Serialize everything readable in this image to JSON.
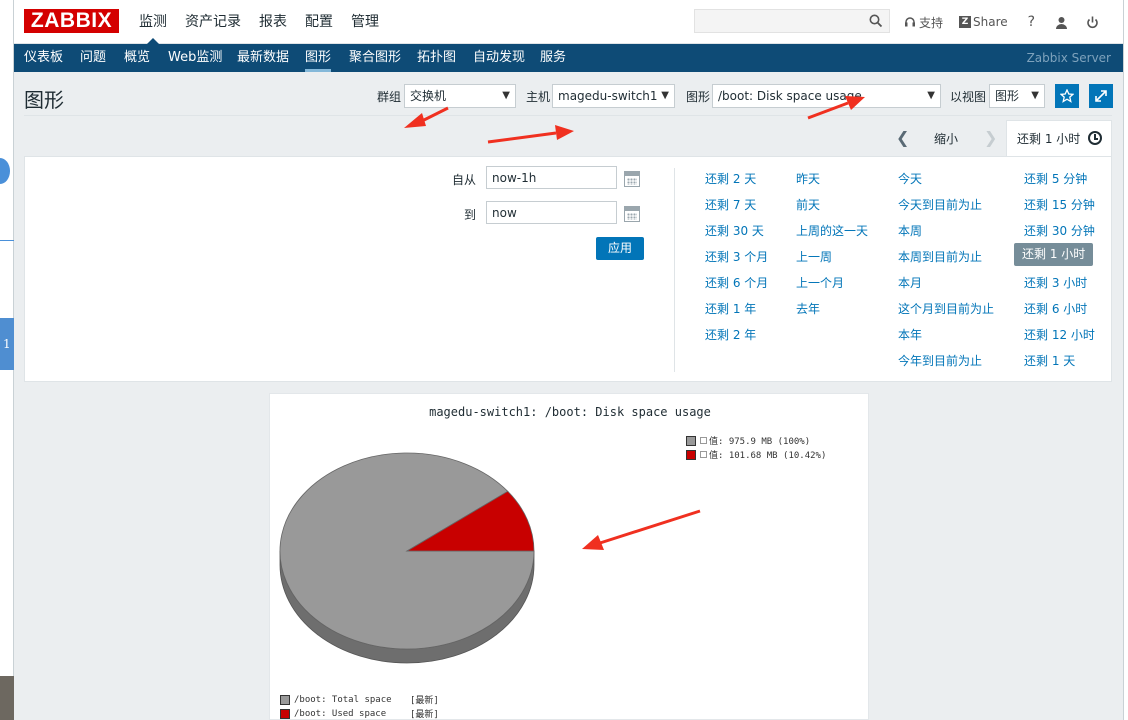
{
  "brand": "ZABBIX",
  "main_menu": [
    "监测",
    "资产记录",
    "报表",
    "配置",
    "管理"
  ],
  "top_links": {
    "support": "支持",
    "share": "Share",
    "help": "?"
  },
  "sub_nav": [
    "仪表板",
    "问题",
    "概览",
    "Web监测",
    "最新数据",
    "图形",
    "聚合图形",
    "拓扑图",
    "自动发现",
    "服务"
  ],
  "server_name": "Zabbix Server",
  "page_title": "图形",
  "filters": {
    "group_label": "群组",
    "group_value": "交换机",
    "host_label": "主机",
    "host_value": "magedu-switch1",
    "graph_label": "图形",
    "graph_value": "/boot: Disk space usage",
    "view_label": "以视图",
    "view_value": "图形"
  },
  "time_tabs": {
    "zoom_out": "缩小",
    "active": "还剩 1 小时"
  },
  "time_filter": {
    "from_label": "自从",
    "from_value": "now-1h",
    "to_label": "到",
    "to_value": "now",
    "apply": "应用"
  },
  "quick_ranges": {
    "col1": [
      "还剩 2 天",
      "还剩 7 天",
      "还剩 30 天",
      "还剩 3 个月",
      "还剩 6 个月",
      "还剩 1 年",
      "还剩 2 年"
    ],
    "col2": [
      "昨天",
      "前天",
      "上周的这一天",
      "上一周",
      "上一个月",
      "去年"
    ],
    "col3": [
      "今天",
      "今天到目前为止",
      "本周",
      "本周到目前为止",
      "本月",
      "这个月到目前为止",
      "本年",
      "今年到目前为止"
    ],
    "col4": [
      "还剩 5 分钟",
      "还剩 15 分钟",
      "还剩 30 分钟",
      "还剩 1 小时",
      "还剩 3 小时",
      "还剩 6 小时",
      "还剩 12 小时",
      "还剩 1 天"
    ],
    "selected": "还剩 1 小时"
  },
  "graph": {
    "title": "magedu-switch1: /boot: Disk space usage",
    "legend_top": [
      {
        "text": "值: 975.9 MB (100%)",
        "color": "#999999"
      },
      {
        "text": "值: 101.68 MB (10.42%)",
        "color": "#c80000"
      }
    ],
    "legend_bottom": [
      {
        "name": "/boot: Total space",
        "tag": "[最新]",
        "color": "#999999"
      },
      {
        "name": "/boot: Used space",
        "tag": "[最新]",
        "color": "#c80000"
      }
    ]
  },
  "chart_data": {
    "type": "pie",
    "title": "magedu-switch1: /boot: Disk space usage",
    "slices": [
      {
        "name": "/boot: Total space",
        "value": 975.9,
        "unit": "MB",
        "percent": 100,
        "color": "#999999"
      },
      {
        "name": "/boot: Used space",
        "value": 101.68,
        "unit": "MB",
        "percent": 10.42,
        "color": "#c80000"
      }
    ]
  }
}
